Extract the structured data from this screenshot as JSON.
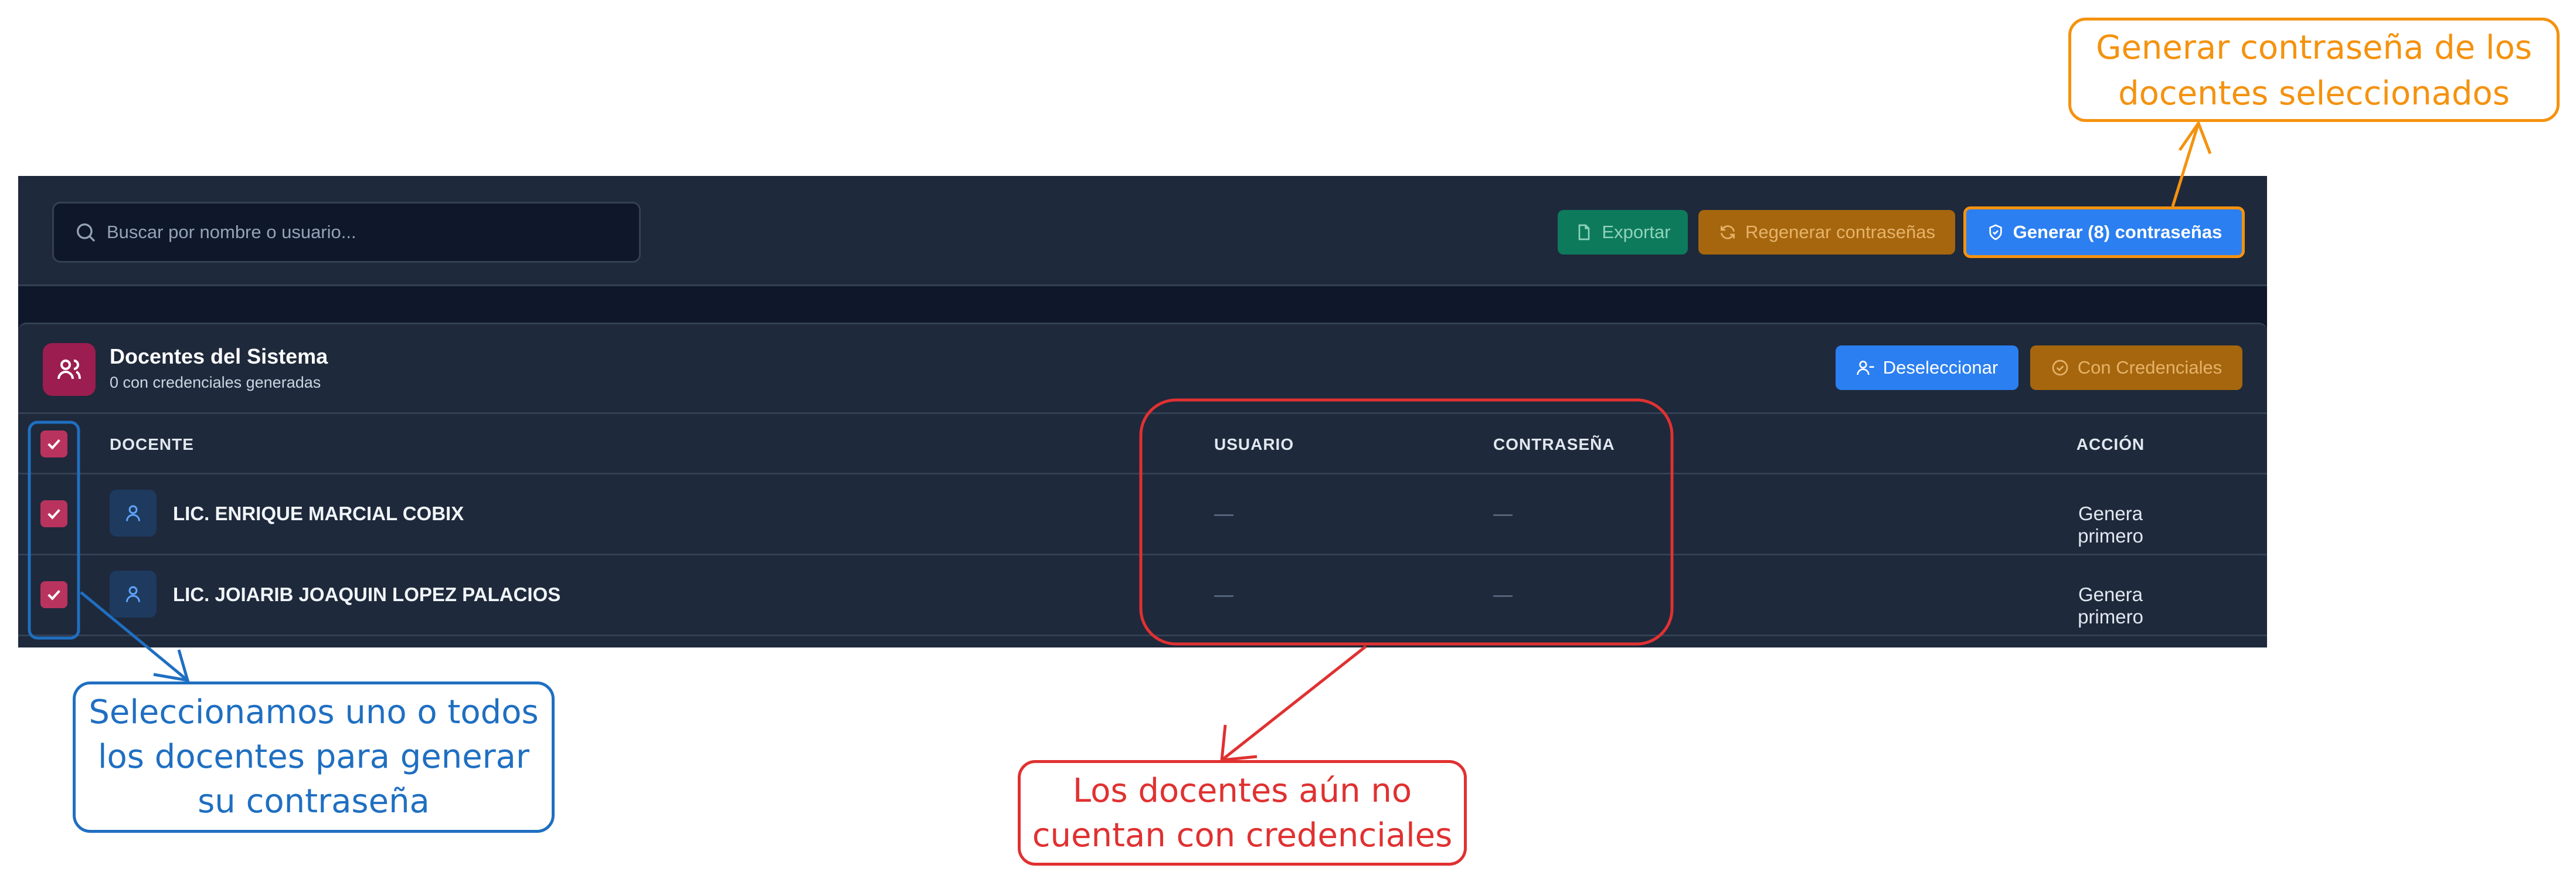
{
  "toolbar": {
    "search_placeholder": "Buscar por nombre o usuario...",
    "export_label": "Exportar",
    "regen_label": "Regenerar contraseñas",
    "generate_label": "Generar (8) contraseñas"
  },
  "panel": {
    "title": "Docentes del Sistema",
    "subtitle": "0 con credenciales generadas",
    "deselect_label": "Deseleccionar",
    "with_credentials_label": "Con Credenciales"
  },
  "table": {
    "headers": {
      "docente": "DOCENTE",
      "usuario": "USUARIO",
      "contrasena": "CONTRASEÑA",
      "accion": "ACCIÓN"
    },
    "rows": [
      {
        "name": "LIC. ENRIQUE MARCIAL COBIX",
        "usuario": "—",
        "contrasena": "—",
        "accion": "Genera primero"
      },
      {
        "name": "LIC. JOIARIB JOAQUIN LOPEZ PALACIOS",
        "usuario": "—",
        "contrasena": "—",
        "accion": "Genera primero"
      }
    ]
  },
  "annotations": {
    "orange": [
      "Generar contraseña de los",
      "docentes seleccionados"
    ],
    "blue": [
      "Seleccionamos uno o todos",
      "los docentes para generar",
      "su contraseña"
    ],
    "red": [
      "Los docentes aún no",
      "cuentan con credenciales"
    ]
  },
  "colors": {
    "orange": "#f4920f",
    "blue": "#1f6fc1",
    "red": "#e03131",
    "app_bg": "#0f172a",
    "panel_bg": "#1e293b"
  }
}
